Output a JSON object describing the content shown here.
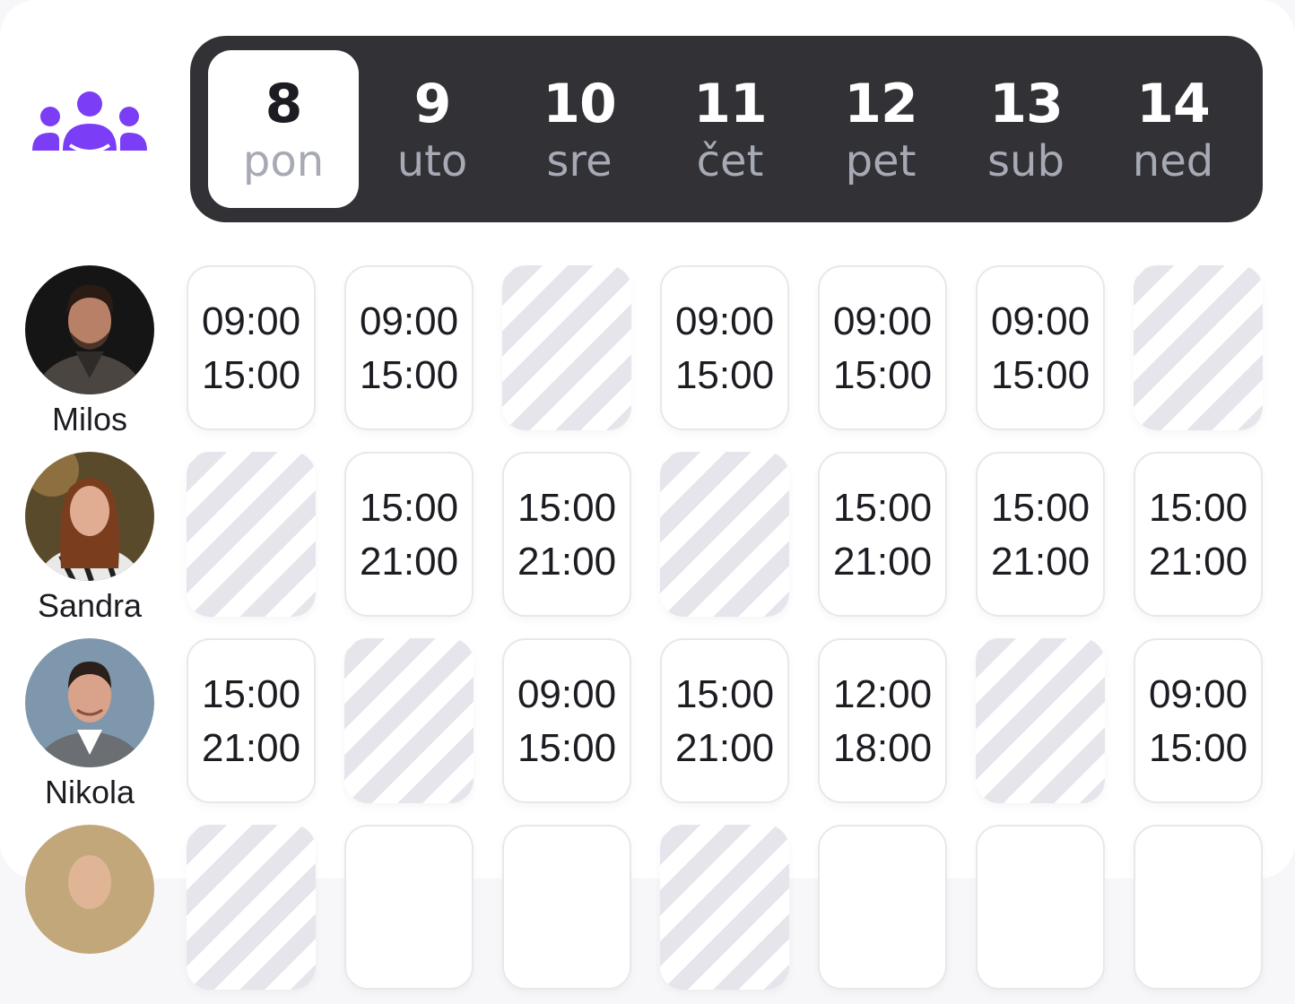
{
  "colors": {
    "accent": "#7b3df5",
    "daybar_bg": "#313136",
    "muted_text": "#a7aab4",
    "off_stripe": "#e6e5ec"
  },
  "header": {
    "team_icon": "team-icon"
  },
  "days": [
    {
      "num": "8",
      "name": "pon",
      "selected": true
    },
    {
      "num": "9",
      "name": "uto"
    },
    {
      "num": "10",
      "name": "sre"
    },
    {
      "num": "11",
      "name": "čet"
    },
    {
      "num": "12",
      "name": "pet"
    },
    {
      "num": "13",
      "name": "sub"
    },
    {
      "num": "14",
      "name": "ned"
    }
  ],
  "staff": [
    {
      "name": "Milos",
      "shifts": [
        {
          "start": "09:00",
          "end": "15:00"
        },
        {
          "start": "09:00",
          "end": "15:00"
        },
        {
          "off": true
        },
        {
          "start": "09:00",
          "end": "15:00"
        },
        {
          "start": "09:00",
          "end": "15:00"
        },
        {
          "start": "09:00",
          "end": "15:00"
        },
        {
          "off": true
        }
      ]
    },
    {
      "name": "Sandra",
      "shifts": [
        {
          "off": true
        },
        {
          "start": "15:00",
          "end": "21:00"
        },
        {
          "start": "15:00",
          "end": "21:00"
        },
        {
          "off": true
        },
        {
          "start": "15:00",
          "end": "21:00"
        },
        {
          "start": "15:00",
          "end": "21:00"
        },
        {
          "start": "15:00",
          "end": "21:00"
        }
      ]
    },
    {
      "name": "Nikola",
      "shifts": [
        {
          "start": "15:00",
          "end": "21:00"
        },
        {
          "off": true
        },
        {
          "start": "09:00",
          "end": "15:00"
        },
        {
          "start": "15:00",
          "end": "21:00"
        },
        {
          "start": "12:00",
          "end": "18:00"
        },
        {
          "off": true
        },
        {
          "start": "09:00",
          "end": "15:00"
        }
      ]
    },
    {
      "name": "",
      "shifts": [
        {
          "off": true
        },
        {
          "start": "",
          "end": ""
        },
        {
          "start": "",
          "end": ""
        },
        {
          "off": true
        },
        {
          "start": "",
          "end": ""
        },
        {
          "start": "",
          "end": ""
        },
        {
          "start": "",
          "end": ""
        }
      ]
    }
  ]
}
